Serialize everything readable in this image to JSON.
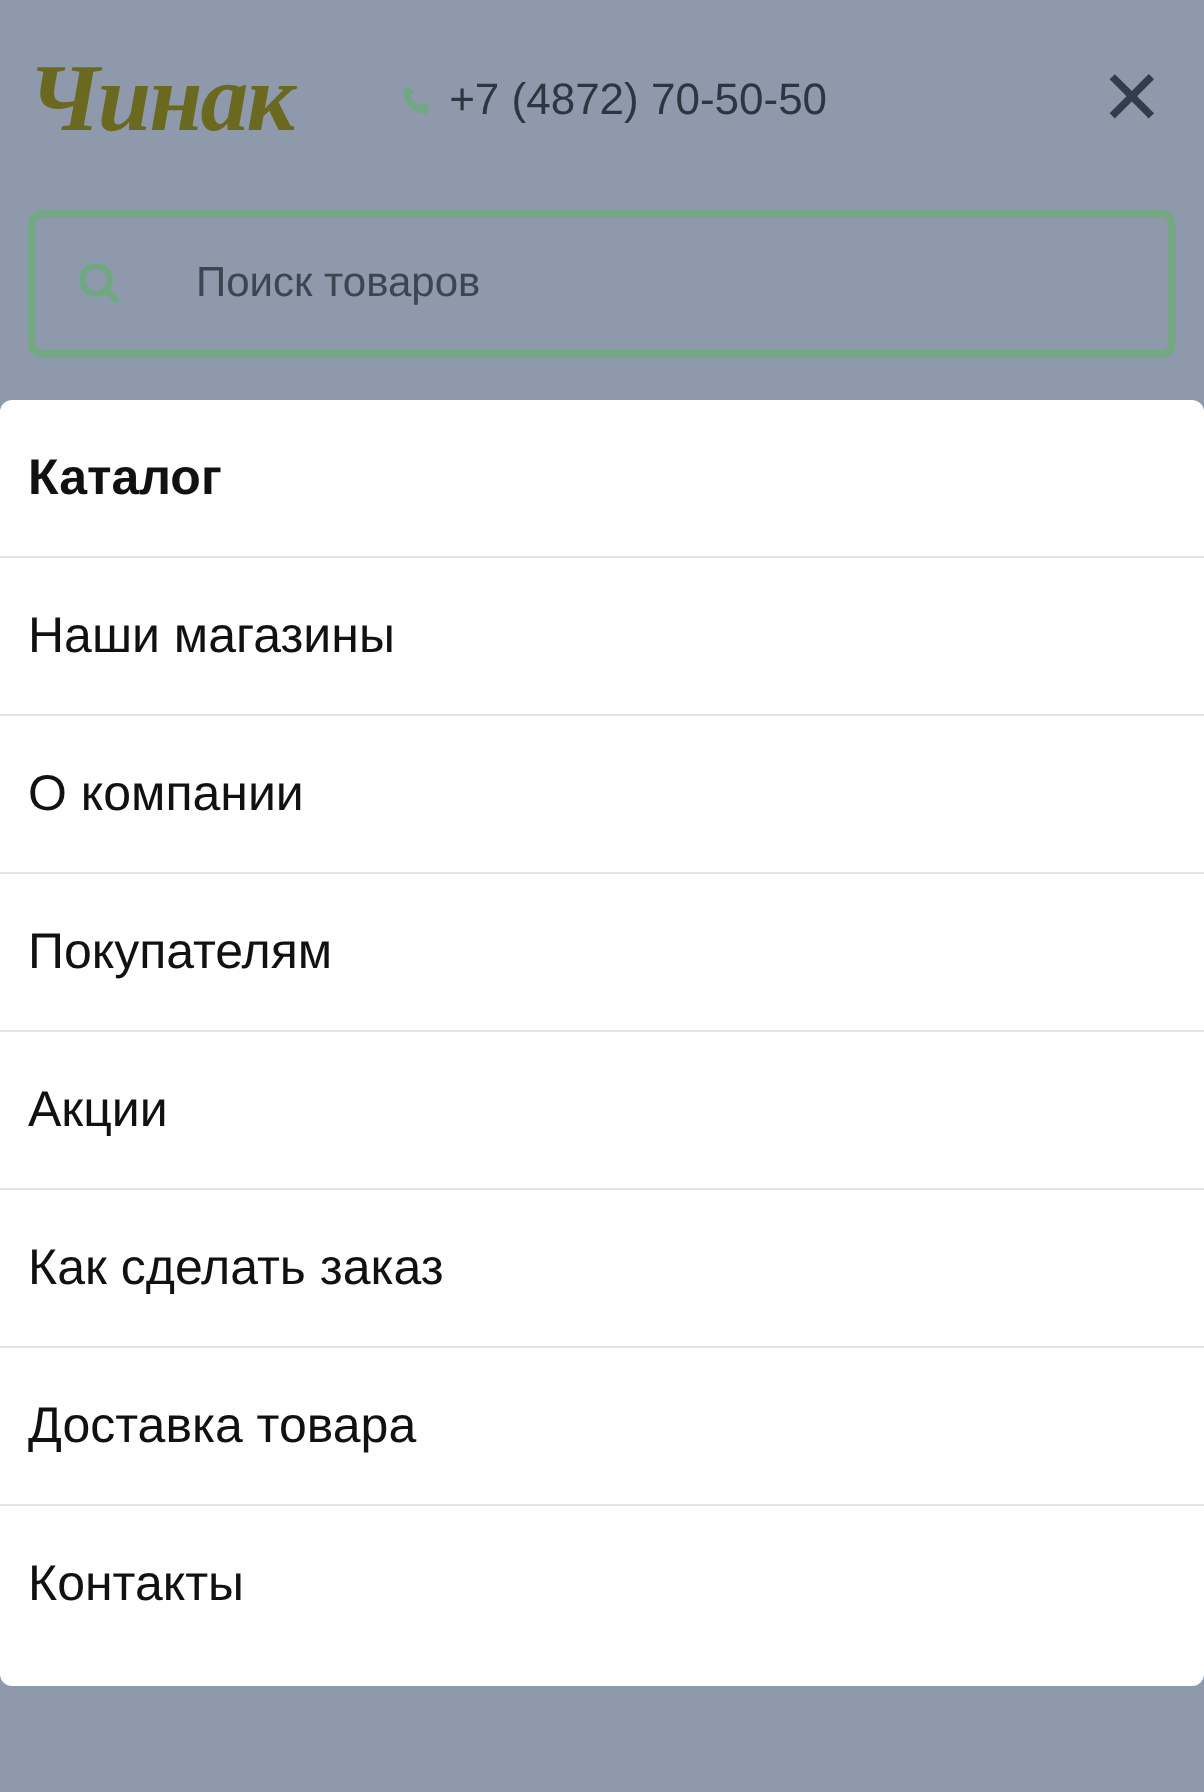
{
  "header": {
    "logo": "Чинак",
    "phone": "+7 (4872) 70-50-50",
    "close": "✕"
  },
  "search": {
    "placeholder": "Поиск товаров"
  },
  "menu": [
    {
      "label": "Каталог",
      "selected": true
    },
    {
      "label": "Наши магазины",
      "selected": false
    },
    {
      "label": "О компании",
      "selected": false
    },
    {
      "label": "Покупателям",
      "selected": false
    },
    {
      "label": "Акции",
      "selected": false
    },
    {
      "label": "Как сделать заказ",
      "selected": false
    },
    {
      "label": "Доставка товара",
      "selected": false
    },
    {
      "label": "Контакты",
      "selected": false
    }
  ]
}
